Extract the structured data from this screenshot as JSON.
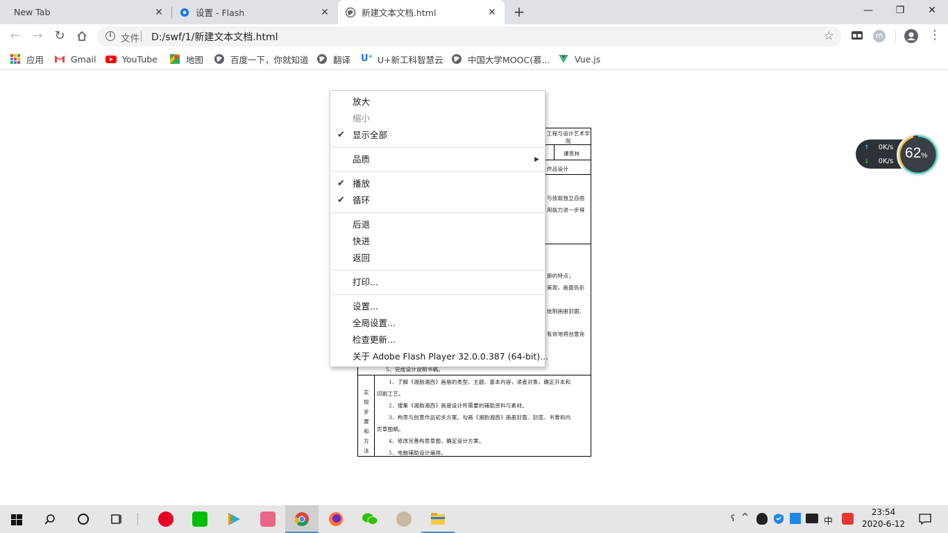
{
  "browser": {
    "tabs": [
      {
        "label": "New Tab"
      },
      {
        "label": "设置 - Flash"
      },
      {
        "label": "新建文本文档.html"
      }
    ],
    "new_tab_label": "+",
    "window_controls": {
      "minimize": "—",
      "restore": "❐",
      "close": "✕"
    },
    "address": {
      "scheme_label": "文件",
      "url": "D:/swf/1/新建文本文档.html"
    },
    "bookmarks": [
      {
        "label": "应用",
        "icon": "apps-grid-icon"
      },
      {
        "label": "Gmail",
        "icon": "gmail-icon"
      },
      {
        "label": "YouTube",
        "icon": "youtube-icon"
      },
      {
        "label": "地图",
        "icon": "maps-icon"
      },
      {
        "label": "百度一下，你就知道",
        "icon": "globe-icon"
      },
      {
        "label": "翻译",
        "icon": "globe-icon"
      },
      {
        "label": "U+新工科智慧云",
        "icon": "u-plus-icon"
      },
      {
        "label": "中国大学MOOC(慕...",
        "icon": "globe-icon"
      },
      {
        "label": "Vue.js",
        "icon": "vue-icon"
      }
    ]
  },
  "document": {
    "header_cell": "工程与设计艺术学院",
    "teacher_cell": "谭思林",
    "subject_cell": "作品设计",
    "rows_text": [
      "与技能独立自由",
      "用能力进一步得",
      "册的特点；",
      "美观，画面色彩",
      "绘制画册封面、",
      "有效地将创意充"
    ],
    "hidden_fragment": "5、完成设计说明书稿。",
    "steps_label": "实现步骤和方法",
    "steps": [
      "1、了解《湘韵湘西》画册的类型、主题、基本内容，读者对象，确定开本和",
      "印刷工艺。",
      "2、搜集《湘韵湘西》画册设计所需要的辅助资料与素材。",
      "3、构思与创意作品初步方案。勾画《湘韵湘西》画册封面、封底、书脊和内",
      "页草图稿。",
      "4、修改完善构思草图，确定设计方案。",
      "5、电脑辅助设计编排。"
    ]
  },
  "context_menu": {
    "zoom_in": "放大",
    "zoom_out": "缩小",
    "show_all": "显示全部",
    "quality": "品质",
    "play": "播放",
    "loop": "循环",
    "rewind": "后退",
    "forward": "快进",
    "back": "返回",
    "print": "打印...",
    "settings": "设置...",
    "global_settings": "全局设置...",
    "check_updates": "检查更新...",
    "about": "关于 Adobe Flash Player 32.0.0.387 (64-bit)..."
  },
  "net_widget": {
    "upload": "0K/s",
    "download": "0K/s",
    "percent": "62",
    "percent_unit": "%"
  },
  "taskbar": {
    "apps": [
      "netease-music-icon",
      "iqiyi-icon",
      "tencent-video-icon",
      "bilibili-icon",
      "chrome-icon",
      "firefox-icon",
      "wechat-icon",
      "avatar-app-icon",
      "file-explorer-icon"
    ],
    "ime": "中",
    "time": "23:54",
    "date": "2020-6-12"
  }
}
